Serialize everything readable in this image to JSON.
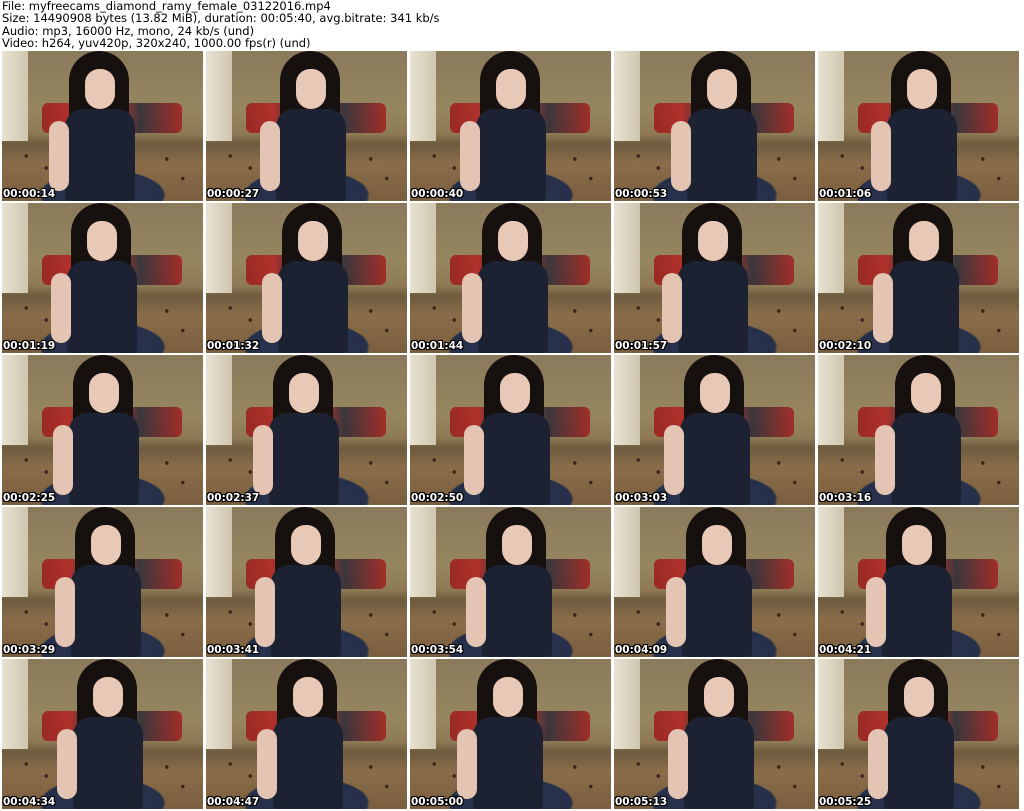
{
  "header": {
    "file_line": "File: myfreecams_diamond_ramy_female_03122016.mp4",
    "size_line": "Size: 14490908 bytes (13.82 MiB), duration: 00:05:40, avg.bitrate: 341 kb/s",
    "audio_line": "Audio: mp3, 16000 Hz, mono, 24 kb/s (und)",
    "video_line": "Video: h264, yuv420p, 320x240, 1000.00 fps(r) (und)"
  },
  "thumbnails": [
    {
      "time": "00:00:14"
    },
    {
      "time": "00:00:27"
    },
    {
      "time": "00:00:40"
    },
    {
      "time": "00:00:53"
    },
    {
      "time": "00:01:06"
    },
    {
      "time": "00:01:19"
    },
    {
      "time": "00:01:32"
    },
    {
      "time": "00:01:44"
    },
    {
      "time": "00:01:57"
    },
    {
      "time": "00:02:10"
    },
    {
      "time": "00:02:25"
    },
    {
      "time": "00:02:37"
    },
    {
      "time": "00:02:50"
    },
    {
      "time": "00:03:03"
    },
    {
      "time": "00:03:16"
    },
    {
      "time": "00:03:29"
    },
    {
      "time": "00:03:41"
    },
    {
      "time": "00:03:54"
    },
    {
      "time": "00:04:09"
    },
    {
      "time": "00:04:21"
    },
    {
      "time": "00:04:34"
    },
    {
      "time": "00:04:47"
    },
    {
      "time": "00:05:00"
    },
    {
      "time": "00:05:13"
    },
    {
      "time": "00:05:25"
    }
  ]
}
